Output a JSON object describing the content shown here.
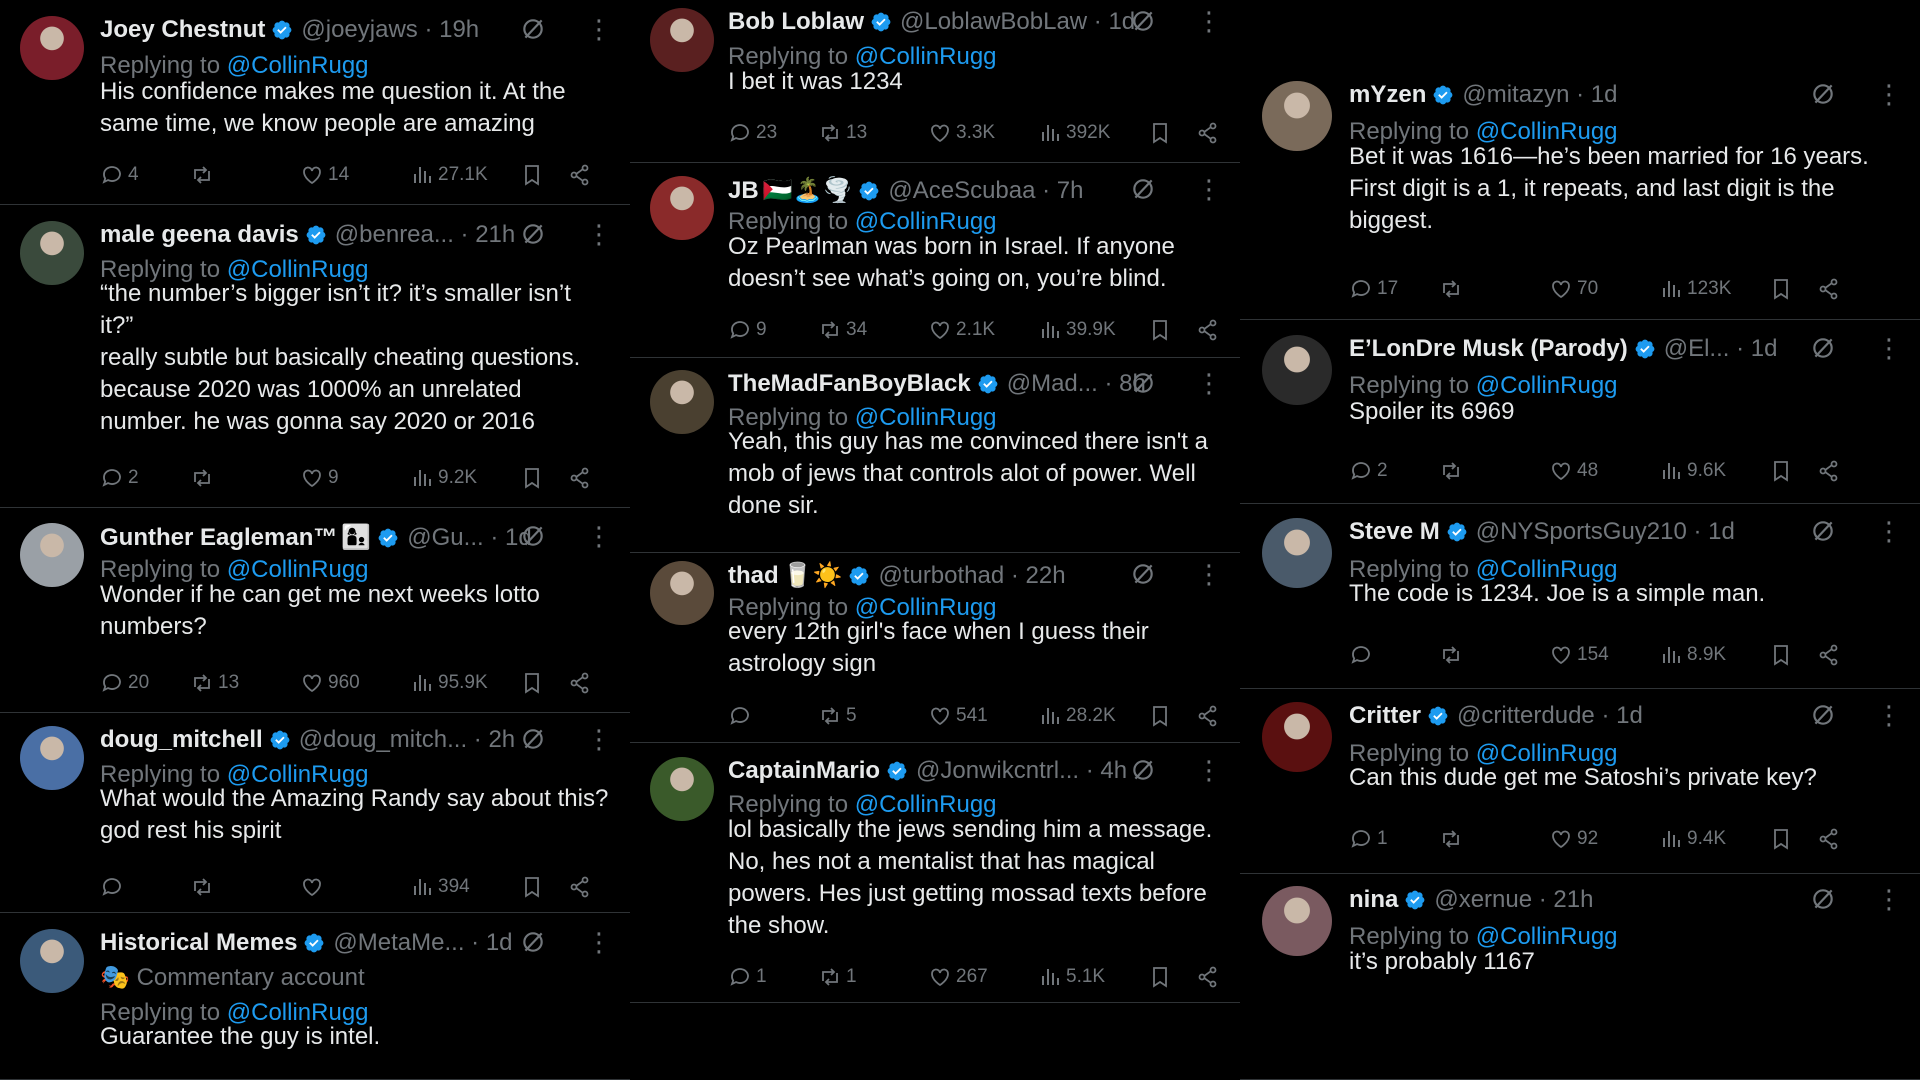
{
  "mention": "@CollinRugg",
  "replying_to": "Replying to",
  "col1": [
    {
      "name": "Joey Chestnut",
      "handle": "@joeyjaws · 19h",
      "text": "His confidence makes me question it. At the same time, we know people are amazing",
      "reply": "4",
      "retweet": "",
      "like": "14",
      "views": "27.1K"
    },
    {
      "name": "male geena davis",
      "handle": "@benrea...   · 21h",
      "text": "“the number’s bigger isn’t it? it’s smaller isn’t it?”\nreally subtle but basically cheating questions. because 2020 was 1000% an unrelated number. he was gonna say 2020 or 2016",
      "reply": "2",
      "retweet": "",
      "like": "9",
      "views": "9.2K"
    },
    {
      "name": "Gunther Eagleman™",
      "emoji": "👩‍👦",
      "handle": "@Gu...   · 1d",
      "text": "Wonder if he can get me next weeks lotto numbers?",
      "reply": "20",
      "retweet": "13",
      "like": "960",
      "views": "95.9K"
    },
    {
      "name": "doug_mitchell",
      "handle": "@doug_mitch...   · 2h",
      "text": "What would the Amazing Randy say about this? god rest his spirit",
      "reply": "",
      "retweet": "",
      "like": "",
      "views": "394"
    },
    {
      "name": "Historical Memes",
      "handle": "@MetaMe...   · 1d",
      "sub": "Commentary account",
      "text": "Guarantee the guy is intel."
    }
  ],
  "col2": [
    {
      "name": "Bob Loblaw",
      "handle": "@LoblawBobLaw · 1d",
      "text": "I bet it was 1234",
      "reply": "23",
      "retweet": "13",
      "like": "3.3K",
      "views": "392K"
    },
    {
      "name": "JB",
      "emoji": "🇵🇸🏝️🌪️",
      "handle": "@AceScubaa · 7h",
      "text": "Oz Pearlman was born in Israel. If anyone doesn’t see what’s going on, you’re blind.",
      "reply": "9",
      "retweet": "34",
      "like": "2.1K",
      "views": "39.9K"
    },
    {
      "name": "TheMadFanBoyBlack",
      "handle": "@Mad...   · 8h",
      "text": "Yeah, this guy has me convinced there isn't a mob of jews that controls alot of power. Well done sir.",
      "reply": "",
      "retweet": "",
      "like": "",
      "views": ""
    },
    {
      "name": "thad",
      "emoji": "🥛☀️",
      "handle": "@turbothad · 22h",
      "text": "every 12th girl's face when I guess their astrology sign",
      "reply": "",
      "retweet": "5",
      "like": "541",
      "views": "28.2K"
    },
    {
      "name": "CaptainMario",
      "handle": "@Jonwikcntrl...   · 4h",
      "text": "lol basically the jews sending him a message. No, hes not a mentalist that has magical powers. Hes just getting mossad texts before the show.",
      "reply": "1",
      "retweet": "1",
      "like": "267",
      "views": "5.1K"
    }
  ],
  "col3": [
    {
      "name": "mYzen",
      "handle": "@mitazyn · 1d",
      "text": "Bet it was 1616—he’s been married for 16 years. First digit is a 1, it repeats, and last digit is the biggest.",
      "reply": "17",
      "retweet": "",
      "like": "70",
      "views": "123K"
    },
    {
      "name": "E’LonDre Musk (Parody)",
      "handle": "@El...   · 1d",
      "text": "Spoiler its 6969",
      "reply": "2",
      "retweet": "",
      "like": "48",
      "views": "9.6K"
    },
    {
      "name": "Steve M",
      "handle": "@NYSportsGuy210 · 1d",
      "text": "The code is 1234. Joe is a simple man.",
      "reply": "",
      "retweet": "",
      "like": "154",
      "views": "8.9K"
    },
    {
      "name": "Critter",
      "handle": "@critterdude · 1d",
      "text": "Can this dude get me Satoshi’s private key?",
      "reply": "1",
      "retweet": "",
      "like": "92",
      "views": "9.4K"
    },
    {
      "name": "nina",
      "handle": "@xernue · 21h",
      "text": "it’s probably 1167"
    }
  ],
  "colors": {
    "accent": "#1d9bf0",
    "muted": "#71767b",
    "text": "#e7e9ea",
    "bg": "#000000"
  },
  "icons": [
    "verified-badge-icon",
    "grok-icon",
    "more-icon",
    "reply-icon",
    "retweet-icon",
    "like-icon",
    "views-icon",
    "bookmark-icon",
    "share-icon"
  ]
}
